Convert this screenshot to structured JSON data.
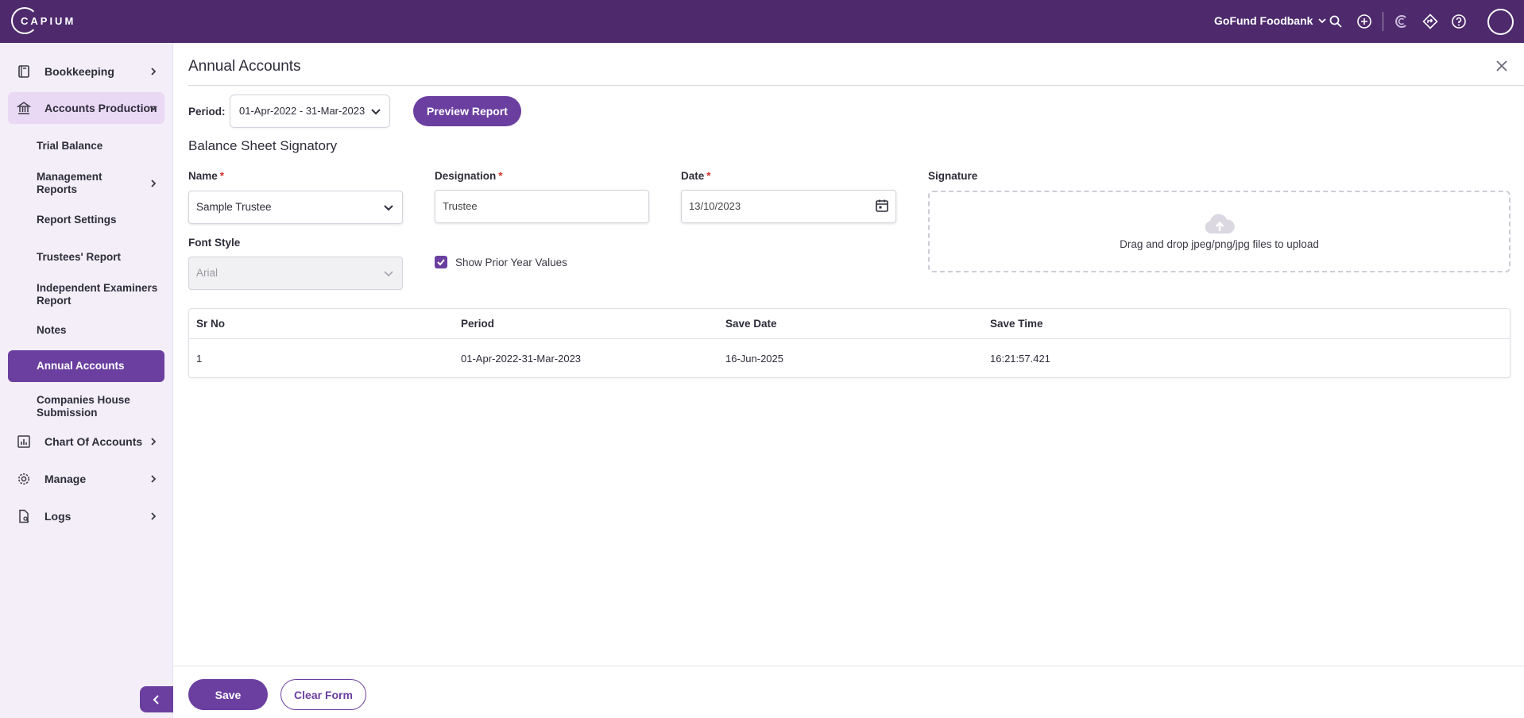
{
  "header": {
    "logo_text": "CAPIUM",
    "org_name": "GoFund Foodbank"
  },
  "sidebar": {
    "items": [
      {
        "label": "Bookkeeping"
      },
      {
        "label": "Accounts Production"
      },
      {
        "label": "Trial Balance"
      },
      {
        "label": "Management Reports"
      },
      {
        "label": "Report Settings"
      },
      {
        "label": "Trustees' Report"
      },
      {
        "label": "Independent Examiners Report"
      },
      {
        "label": "Notes"
      },
      {
        "label": "Annual Accounts"
      },
      {
        "label": "Companies House Submission"
      },
      {
        "label": "Chart Of Accounts"
      },
      {
        "label": "Manage"
      },
      {
        "label": "Logs"
      }
    ]
  },
  "main": {
    "title": "Annual Accounts",
    "period_label": "Period:",
    "period_value": "01-Apr-2022 - 31-Mar-2023",
    "preview_button": "Preview Report",
    "section_title": "Balance Sheet Signatory",
    "fields": {
      "name_label": "Name",
      "name_value": "Sample Trustee",
      "designation_label": "Designation",
      "designation_value": "Trustee",
      "date_label": "Date",
      "date_value": "13/10/2023",
      "signature_label": "Signature",
      "signature_drop_text": "Drag and drop jpeg/png/jpg files to upload",
      "font_style_label": "Font Style",
      "font_style_value": "Arial",
      "show_prior_label": "Show Prior Year Values",
      "required_mark": "*"
    },
    "table": {
      "headers": [
        "Sr No",
        "Period",
        "Save Date",
        "Save Time"
      ],
      "rows": [
        [
          "1",
          "01-Apr-2022-31-Mar-2023",
          "16-Jun-2025",
          "16:21:57.421"
        ]
      ]
    },
    "footer": {
      "save_button": "Save",
      "clear_button": "Clear Form"
    }
  },
  "colors": {
    "brand": "#4e2a6c",
    "accent": "#6b3fa0",
    "sidebar_bg": "#f3eef8",
    "required": "#d0322c"
  }
}
